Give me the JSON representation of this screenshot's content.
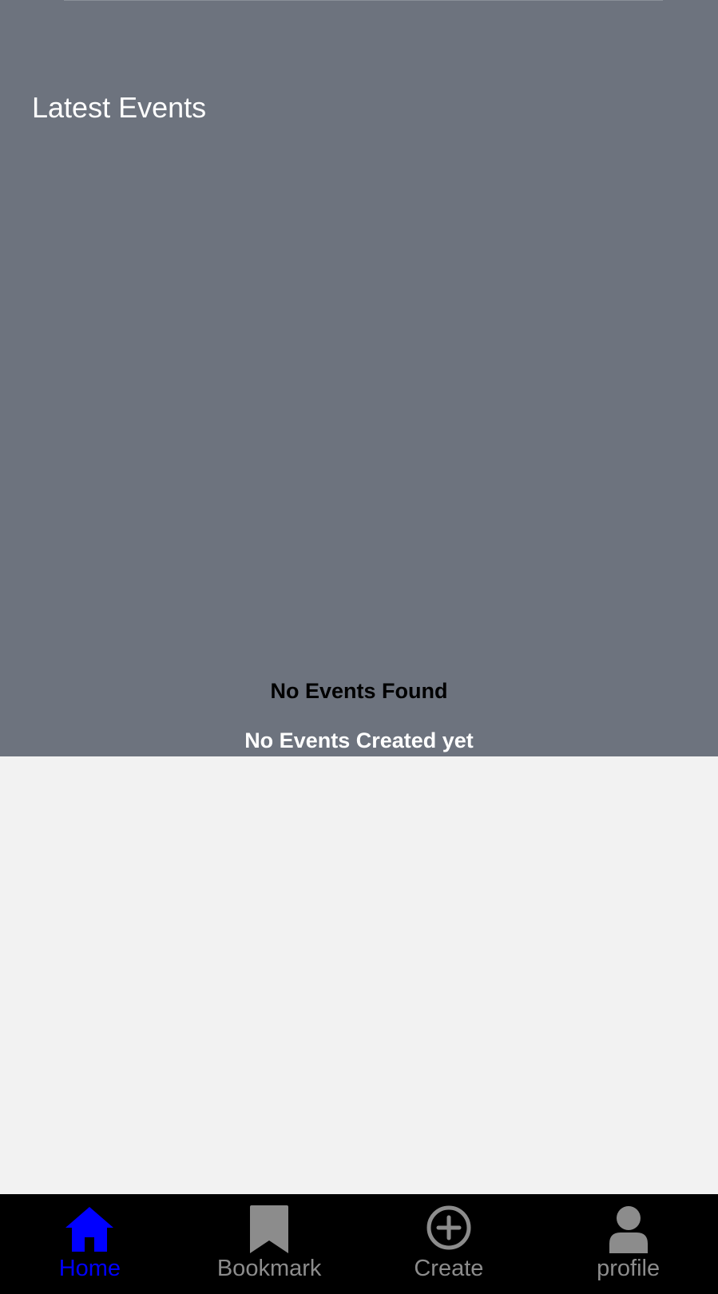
{
  "colors": {
    "panel_bg": "#6d737e",
    "content_bg": "#f2f2f2",
    "nav_bg": "#000000",
    "nav_active": "#0000ff",
    "nav_inactive": "#8c8c8c"
  },
  "events": {
    "section_title": "Latest Events",
    "empty_title": "No Events Found",
    "empty_subtitle": "No Events Created yet"
  },
  "bottom_nav": {
    "items": [
      {
        "label": "Home",
        "icon": "home-icon",
        "active": true
      },
      {
        "label": "Bookmark",
        "icon": "bookmark-icon",
        "active": false
      },
      {
        "label": "Create",
        "icon": "plus-circle-icon",
        "active": false
      },
      {
        "label": "profile",
        "icon": "user-icon",
        "active": false
      }
    ]
  }
}
